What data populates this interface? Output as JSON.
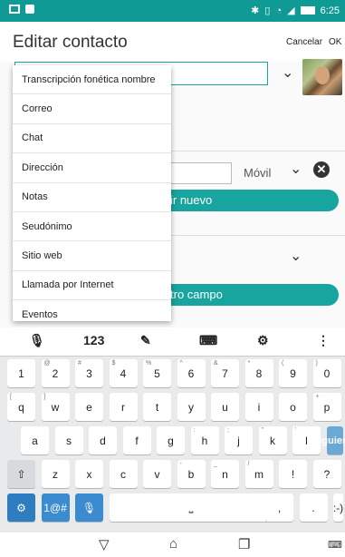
{
  "status_bar": {
    "time": "6:25",
    "icons": [
      "notification-icon",
      "image-icon",
      "bluetooth-icon",
      "vibrate-icon",
      "wifi-icon",
      "signal-icon",
      "battery-icon"
    ]
  },
  "header": {
    "title": "Editar contacto",
    "cancel_label": "Cancelar",
    "ok_label": "OK"
  },
  "form": {
    "phone_type": "Móvil",
    "add_new_label": "ir nuevo",
    "add_field_label": "tro campo"
  },
  "dropdown": {
    "items": [
      "Transcripción fonética nombre",
      "Correo",
      "Chat",
      "Dirección",
      "Notas",
      "Seudónimo",
      "Sitio web",
      "Llamada por Internet",
      "Eventos"
    ]
  },
  "keyboard": {
    "toolbar": {
      "numbers_label": "123"
    },
    "row1": [
      {
        "k": "1",
        "s": ""
      },
      {
        "k": "2",
        "s": "@"
      },
      {
        "k": "3",
        "s": "#"
      },
      {
        "k": "4",
        "s": "$"
      },
      {
        "k": "5",
        "s": "%"
      },
      {
        "k": "6",
        "s": "^"
      },
      {
        "k": "7",
        "s": "&"
      },
      {
        "k": "8",
        "s": "*"
      },
      {
        "k": "9",
        "s": "("
      },
      {
        "k": "0",
        "s": ")"
      }
    ],
    "row2": [
      {
        "k": "q",
        "s": "["
      },
      {
        "k": "w",
        "s": "]"
      },
      {
        "k": "e",
        "s": ""
      },
      {
        "k": "r",
        "s": ""
      },
      {
        "k": "t",
        "s": ""
      },
      {
        "k": "y",
        "s": ""
      },
      {
        "k": "u",
        "s": ""
      },
      {
        "k": "i",
        "s": ""
      },
      {
        "k": "o",
        "s": ""
      },
      {
        "k": "p",
        "s": "+"
      }
    ],
    "row3": [
      {
        "k": "a",
        "s": ""
      },
      {
        "k": "s",
        "s": ""
      },
      {
        "k": "d",
        "s": ""
      },
      {
        "k": "f",
        "s": ""
      },
      {
        "k": "g",
        "s": ""
      },
      {
        "k": "h",
        "s": ":"
      },
      {
        "k": "j",
        "s": ";"
      },
      {
        "k": "k",
        "s": "\""
      },
      {
        "k": "l",
        "s": "'"
      }
    ],
    "enter_label": "Siguiente",
    "row4": [
      {
        "k": "z",
        "s": ""
      },
      {
        "k": "x",
        "s": ""
      },
      {
        "k": "c",
        "s": ""
      },
      {
        "k": "v",
        "s": ""
      },
      {
        "k": "b",
        "s": "-"
      },
      {
        "k": "n",
        "s": "_"
      },
      {
        "k": "m",
        "s": "/"
      },
      {
        "k": "!",
        "s": ""
      },
      {
        "k": "?",
        "s": ""
      }
    ],
    "symbols_label": "1@#",
    "comma_label": ",",
    "period_label": ".",
    "emoticon_label": ":-)"
  }
}
